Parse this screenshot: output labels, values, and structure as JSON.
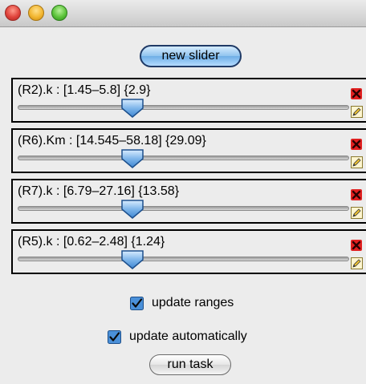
{
  "window": {
    "title": ""
  },
  "toolbar": {
    "new_slider_label": "new slider"
  },
  "sliders": [
    {
      "label": "(R2).k : [1.45–5.8] {2.9}",
      "min": 1.45,
      "max": 5.8,
      "value": 2.9
    },
    {
      "label": "(R6).Km : [14.545–58.18] {29.09}",
      "min": 14.545,
      "max": 58.18,
      "value": 29.09
    },
    {
      "label": "(R7).k : [6.79–27.16] {13.58}",
      "min": 6.79,
      "max": 27.16,
      "value": 13.58
    },
    {
      "label": "(R5).k : [0.62–2.48] {1.24}",
      "min": 0.62,
      "max": 2.48,
      "value": 1.24
    }
  ],
  "options": {
    "update_ranges_label": "update ranges",
    "update_ranges_checked": true,
    "update_automatically_label": "update automatically",
    "update_automatically_checked": true
  },
  "actions": {
    "run_task_label": "run task"
  },
  "icons": {
    "delete": "delete-x-icon",
    "edit": "pencil-edit-icon",
    "checkbox": "checkmark-icon"
  },
  "colors": {
    "accent_blue": "#6eaee6",
    "delete_red": "#cc1111",
    "pencil_yellow": "#f2c530"
  }
}
